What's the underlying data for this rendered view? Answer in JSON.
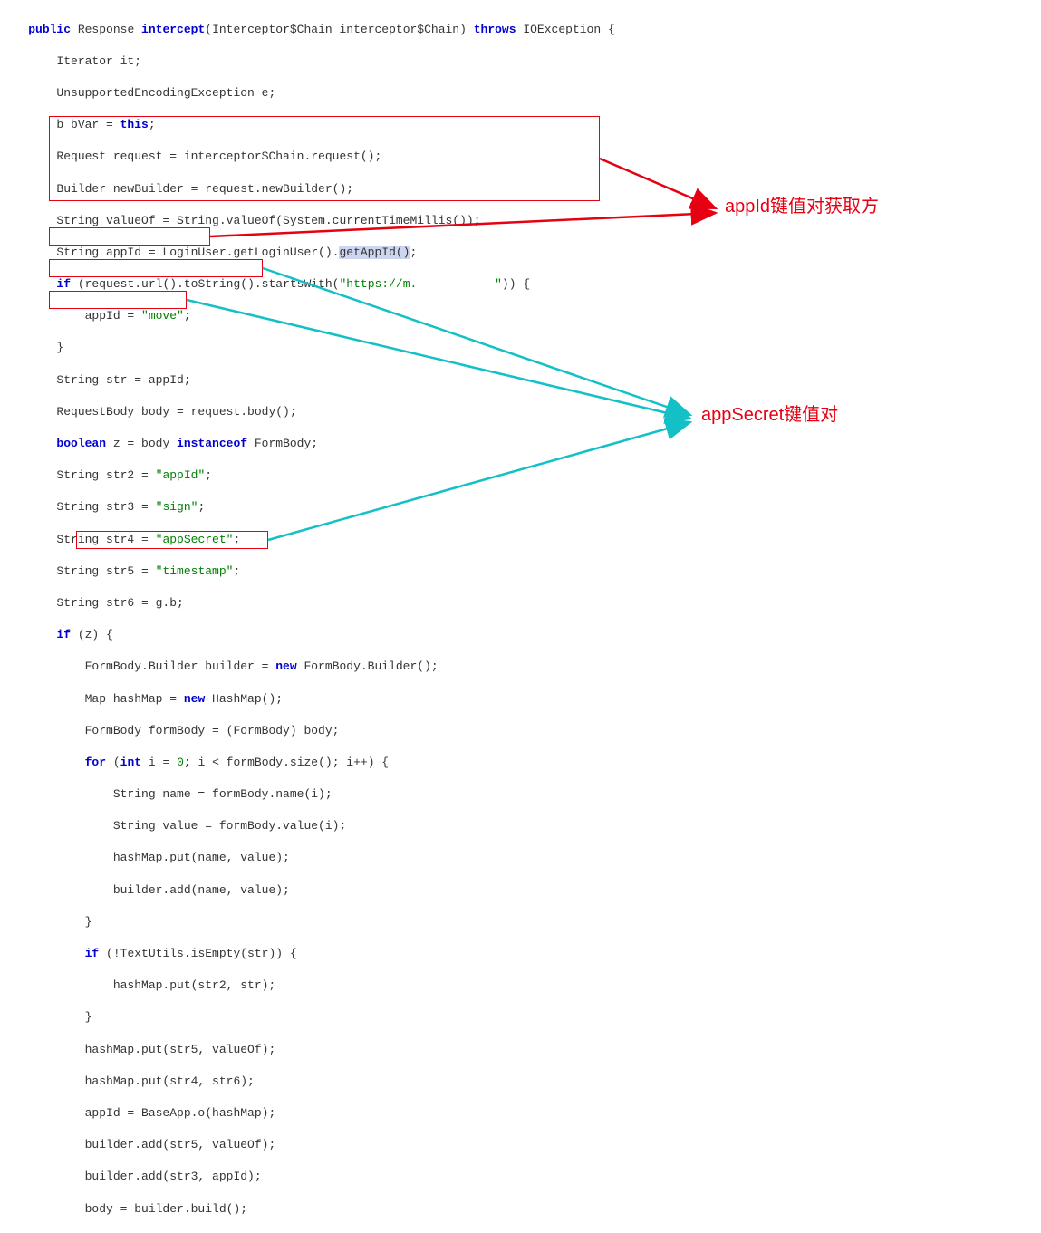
{
  "annotations": {
    "appid": "appId键值对获取方",
    "appsecret": "appSecret键值对"
  },
  "code": {
    "l1_a": "    ",
    "l1_kw": "public",
    "l1_b": " Response ",
    "l1_fn": "intercept",
    "l1_c": "(Interceptor$Chain interceptor$Chain) ",
    "l1_kw2": "throws",
    "l1_d": " IOException {",
    "l2": "        Iterator it;",
    "l3": "        UnsupportedEncodingException e;",
    "l4_a": "        b bVar = ",
    "l4_kw": "this",
    "l4_b": ";",
    "l5": "        Request request = interceptor$Chain.request();",
    "l6": "        Builder newBuilder = request.newBuilder();",
    "l7": "        String valueOf = String.valueOf(System.currentTimeMillis());",
    "l8_a": "        String appId = LoginUser.getLoginUser().",
    "l8_hl": "getAppId()",
    "l8_b": ";",
    "l9_a": "        ",
    "l9_kw": "if",
    "l9_b": " (request.url().toString().startsWith(",
    "l9_str": "\"https://m.           \"",
    "l9_c": ")) {",
    "l10_a": "            appId = ",
    "l10_str": "\"move\"",
    "l10_b": ";",
    "l11": "        }",
    "l12": "        String str = appId;",
    "l13": "        RequestBody body = request.body();",
    "l14_a": "        ",
    "l14_kw": "boolean",
    "l14_b": " z = body ",
    "l14_kw2": "instanceof",
    "l14_c": " FormBody;",
    "l15_a": "        String str2 = ",
    "l15_str": "\"appId\"",
    "l15_b": ";",
    "l16_a": "        String str3 = ",
    "l16_str": "\"sign\"",
    "l16_b": ";",
    "l17_a": "        String str4 = ",
    "l17_str": "\"appSecret\"",
    "l17_b": ";",
    "l18_a": "        String str5 = ",
    "l18_str": "\"timestamp\"",
    "l18_b": ";",
    "l19_a": "        String str6 = g.b;",
    "l20_a": "        ",
    "l20_kw": "if",
    "l20_b": " (z) {",
    "l21_a": "            FormBody.Builder builder = ",
    "l21_kw": "new",
    "l21_b": " FormBody.Builder();",
    "l22_a": "            Map hashMap = ",
    "l22_kw": "new",
    "l22_b": " HashMap();",
    "l23": "            FormBody formBody = (FormBody) body;",
    "l24_a": "            ",
    "l24_kw": "for",
    "l24_b": " (",
    "l24_kw2": "int",
    "l24_c": " i = ",
    "l24_num": "0",
    "l24_d": "; i < formBody.size(); i++) {",
    "l25": "                String name = formBody.name(i);",
    "l26": "                String value = formBody.value(i);",
    "l27": "                hashMap.put(name, value);",
    "l28": "                builder.add(name, value);",
    "l29": "            }",
    "l30_a": "            ",
    "l30_kw": "if",
    "l30_b": " (!TextUtils.isEmpty(str)) {",
    "l31": "                hashMap.put(str2, str);",
    "l32": "            }",
    "l33": "            hashMap.put(str5, valueOf);",
    "l34": "            hashMap.put(str4, str6);",
    "l35": "            appId = BaseApp.o(hashMap);",
    "l36": "            builder.add(str5, valueOf);",
    "l37": "            builder.add(str3, appId);",
    "l38": "            body = builder.build();"
  }
}
